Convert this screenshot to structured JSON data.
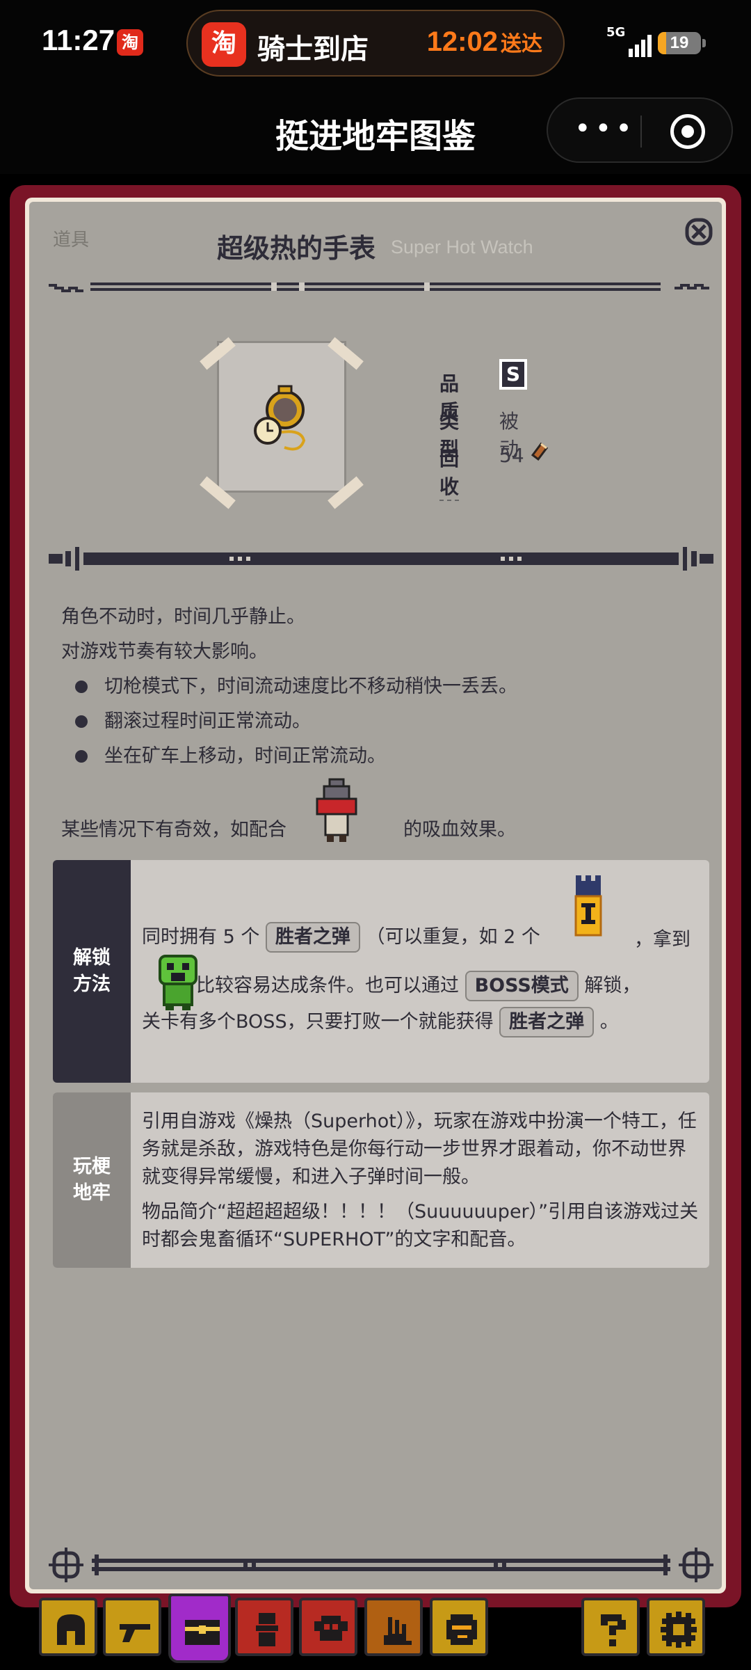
{
  "status_bar": {
    "time": "11:27",
    "app_badge": "淘",
    "network": "5G",
    "battery": "19",
    "battery_level": 0.19
  },
  "live_pill": {
    "icon": "淘",
    "title": "骑士到店",
    "eta_time": "12:02",
    "eta_label": "送达"
  },
  "navbar": {
    "title": "挺进地牢图鉴",
    "more_label": "•••"
  },
  "item": {
    "category": "道具",
    "name": "超级热的手表",
    "name_en": "Super Hot Watch",
    "properties": [
      {
        "label": "品质",
        "value": "S"
      },
      {
        "label": "类型",
        "value": "被动"
      },
      {
        "label": "回收",
        "value": "54"
      }
    ]
  },
  "description": {
    "lines": [
      "角色不动时，时间几乎静止。",
      "对游戏节奏有较大影响。"
    ],
    "bullets": [
      "切枪模式下，时间流动速度比不移动稍快一丢丢。",
      "翻滚过程时间正常流动。",
      "坐在矿车上移动，时间正常流动。"
    ],
    "synergy_before": "某些情况下有奇效，如配合",
    "synergy_after": "的吸血效果。"
  },
  "unlock": {
    "label_line1": "解锁",
    "label_line2": "方法",
    "t1": "同时拥有 5 个",
    "tag1": "胜者之弹",
    "t2": "（可以重复，如 2 个",
    "t3": "，拿到",
    "t4": "比较容易达成条件。也可以通过",
    "tag2": "BOSS模式",
    "t5": "解锁，",
    "t6": "关卡有多个BOSS，只要打败一个就能获得",
    "tag3": "胜者之弹",
    "t7": "。"
  },
  "trivia": {
    "label_line1": "玩梗",
    "label_line2": "地牢",
    "para1": "引用自游戏《燥热（Superhot）》，玩家在游戏中扮演一个特工，任务就是杀敌，游戏特色是你每行动一步世界才跟着动，你不动世界就变得异常缓慢，和进入子弹时间一般。",
    "para2": "物品简介“超超超超级！！！！（Suuuuuuper）”引用自该游戏过关时都会鬼畜循环“SUPERHOT”的文字和配音。"
  },
  "tabs": [
    {
      "icon": "helmet-icon",
      "color": "#c79a16"
    },
    {
      "icon": "gun-icon",
      "color": "#c79a16"
    },
    {
      "icon": "chest-icon",
      "color": "#a12bc9"
    },
    {
      "icon": "gungeoneer-icon",
      "color": "#b72a22"
    },
    {
      "icon": "skull-icon",
      "color": "#b72a22"
    },
    {
      "icon": "hand-icon",
      "color": "#b06012"
    },
    {
      "icon": "face-icon",
      "color": "#c79a16"
    },
    {
      "icon": "question-icon",
      "color": "#c79a16"
    },
    {
      "icon": "settings-icon",
      "color": "#c79a16"
    }
  ],
  "colors": {
    "frame": "#7a1427",
    "card": "#a6a39d",
    "dark": "#2f2d3a",
    "accent_orange": "#ff7a1a"
  }
}
